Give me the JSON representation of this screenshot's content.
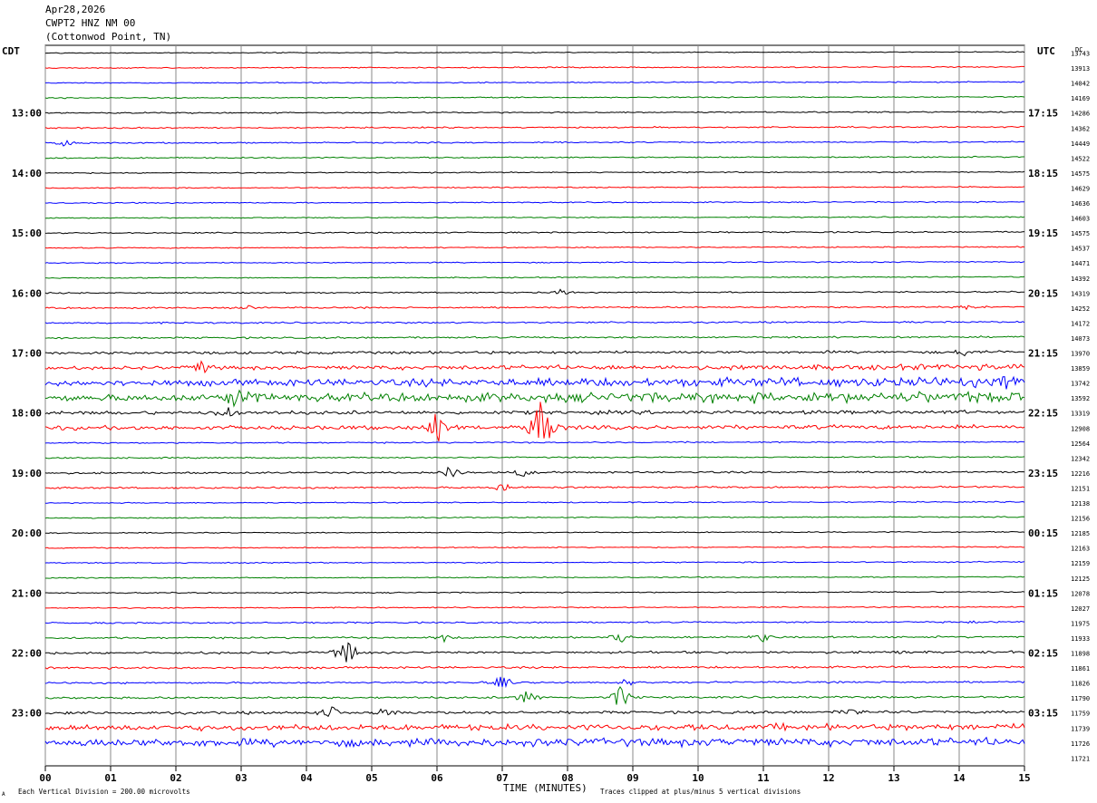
{
  "header": {
    "date": "Apr28,2026",
    "station": "CWPT2 HNZ NM 00",
    "location": "(Cottonwod Point, TN)"
  },
  "left_tz": "CDT",
  "right_tz": "UTC",
  "dc_label": "DC",
  "footer": {
    "xlabel": "TIME (MINUTES)",
    "division_note": "Each Vertical Division =  200.00 microvolts",
    "clip_note": "Traces clipped at plus/minus 5 vertical divisions",
    "corner_mark": "A"
  },
  "colors": {
    "trace_cycle": [
      "#000000",
      "#ff0000",
      "#0000ff",
      "#008000"
    ],
    "grid": "#000000"
  },
  "chart_data": {
    "type": "line",
    "title": "CWPT2 HNZ NM 00",
    "xlabel": "TIME (MINUTES)",
    "ylabel": "",
    "xlim": [
      0,
      15
    ],
    "x_ticks": [
      "00",
      "01",
      "02",
      "03",
      "04",
      "05",
      "06",
      "07",
      "08",
      "09",
      "10",
      "11",
      "12",
      "13",
      "14",
      "15"
    ],
    "minutes_per_line": 15,
    "num_lines": 47,
    "left_hour_labels": [
      {
        "line": 4,
        "label": "13:00"
      },
      {
        "line": 8,
        "label": "14:00"
      },
      {
        "line": 12,
        "label": "15:00"
      },
      {
        "line": 16,
        "label": "16:00"
      },
      {
        "line": 20,
        "label": "17:00"
      },
      {
        "line": 24,
        "label": "18:00"
      },
      {
        "line": 28,
        "label": "19:00"
      },
      {
        "line": 32,
        "label": "20:00"
      },
      {
        "line": 36,
        "label": "21:00"
      },
      {
        "line": 40,
        "label": "22:00"
      },
      {
        "line": 44,
        "label": "23:00"
      }
    ],
    "right_hour_labels": [
      {
        "line": 4,
        "label": "17:15"
      },
      {
        "line": 8,
        "label": "18:15"
      },
      {
        "line": 12,
        "label": "19:15"
      },
      {
        "line": 16,
        "label": "20:15"
      },
      {
        "line": 20,
        "label": "21:15"
      },
      {
        "line": 24,
        "label": "22:15"
      },
      {
        "line": 28,
        "label": "23:15"
      },
      {
        "line": 32,
        "label": "00:15"
      },
      {
        "line": 36,
        "label": "01:15"
      },
      {
        "line": 40,
        "label": "02:15"
      },
      {
        "line": 44,
        "label": "03:15"
      }
    ],
    "dc_offsets": [
      13743,
      13913,
      14042,
      14169,
      14286,
      14362,
      14449,
      14522,
      14575,
      14629,
      14636,
      14603,
      14575,
      14537,
      14471,
      14392,
      14319,
      14252,
      14172,
      14073,
      13970,
      13859,
      13742,
      13592,
      13319,
      12908,
      12564,
      12342,
      12216,
      12151,
      12138,
      12156,
      12185,
      12163,
      12159,
      12125,
      12078,
      12027,
      11975,
      11933,
      11898,
      11861,
      11826,
      11790,
      11759,
      11739,
      11726,
      11721
    ],
    "noise_level": [
      0.4,
      0.5,
      0.5,
      0.5,
      0.6,
      0.6,
      0.6,
      0.6,
      0.5,
      0.5,
      0.5,
      0.5,
      0.6,
      0.5,
      0.5,
      0.5,
      0.6,
      0.7,
      0.7,
      0.8,
      1.2,
      2.0,
      3.5,
      4.0,
      1.6,
      1.8,
      0.6,
      0.6,
      0.8,
      0.8,
      0.5,
      0.5,
      0.5,
      0.5,
      0.5,
      0.5,
      0.5,
      0.5,
      0.7,
      0.8,
      1.0,
      0.9,
      0.8,
      0.9,
      1.2,
      2.6,
      3.5,
      3.8
    ],
    "events": [
      {
        "line": 6,
        "minute": 0.3,
        "amp": 4
      },
      {
        "line": 16,
        "minute": 7.9,
        "amp": 4
      },
      {
        "line": 17,
        "minute": 3.1,
        "amp": 3
      },
      {
        "line": 17,
        "minute": 14.1,
        "amp": 4
      },
      {
        "line": 20,
        "minute": 14.1,
        "amp": 5
      },
      {
        "line": 21,
        "minute": 2.4,
        "amp": 8
      },
      {
        "line": 22,
        "minute": 14.7,
        "amp": 9
      },
      {
        "line": 23,
        "minute": 2.9,
        "amp": 14
      },
      {
        "line": 23,
        "minute": 3.2,
        "amp": 12
      },
      {
        "line": 24,
        "minute": 2.8,
        "amp": 9
      },
      {
        "line": 25,
        "minute": 6.0,
        "amp": 22
      },
      {
        "line": 25,
        "minute": 7.6,
        "amp": 40
      },
      {
        "line": 28,
        "minute": 6.2,
        "amp": 8
      },
      {
        "line": 28,
        "minute": 7.3,
        "amp": 6
      },
      {
        "line": 29,
        "minute": 7.0,
        "amp": 5
      },
      {
        "line": 38,
        "minute": 14.2,
        "amp": 3
      },
      {
        "line": 39,
        "minute": 6.1,
        "amp": 5
      },
      {
        "line": 39,
        "minute": 8.8,
        "amp": 7
      },
      {
        "line": 39,
        "minute": 11.0,
        "amp": 6
      },
      {
        "line": 40,
        "minute": 4.6,
        "amp": 18
      },
      {
        "line": 40,
        "minute": 13.1,
        "amp": 4
      },
      {
        "line": 42,
        "minute": 7.0,
        "amp": 8
      },
      {
        "line": 42,
        "minute": 8.9,
        "amp": 5
      },
      {
        "line": 43,
        "minute": 7.4,
        "amp": 11
      },
      {
        "line": 43,
        "minute": 8.8,
        "amp": 14
      },
      {
        "line": 44,
        "minute": 4.4,
        "amp": 9
      },
      {
        "line": 44,
        "minute": 5.2,
        "amp": 6
      },
      {
        "line": 44,
        "minute": 12.4,
        "amp": 10
      },
      {
        "line": 45,
        "minute": 11.3,
        "amp": 4
      }
    ]
  }
}
